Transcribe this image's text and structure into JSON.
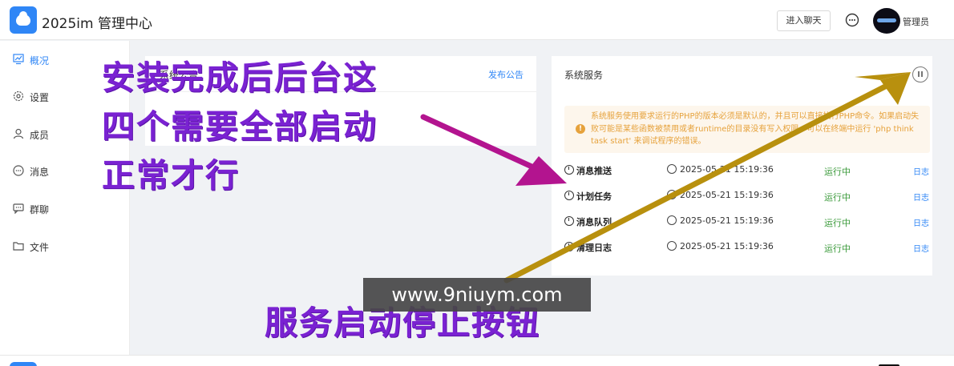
{
  "header": {
    "app_title": "2025im 管理中心",
    "chat_button": "进入聊天",
    "admin_name": "管理员"
  },
  "sidebar": {
    "items": [
      {
        "label": "概况",
        "icon": "dashboard-icon",
        "active": true
      },
      {
        "label": "设置",
        "icon": "gear-icon"
      },
      {
        "label": "成员",
        "icon": "user-icon"
      },
      {
        "label": "消息",
        "icon": "message-icon"
      },
      {
        "label": "群聊",
        "icon": "group-chat-icon"
      },
      {
        "label": "文件",
        "icon": "folder-icon"
      }
    ]
  },
  "announcement": {
    "title": "系统公告",
    "publish_link": "发布公告"
  },
  "services": {
    "title": "系统服务",
    "notice": "系统服务使用要求运行的PHP的版本必须是默认的，并且可以直接执行PHP命令。如果启动失败可能是某些函数被禁用或者runtime的目录没有写入权限，可以在终端中运行 'php think task start' 来调试程序的错误。",
    "rows": [
      {
        "name": "消息推送",
        "time": "2025-05-21 15:19:36",
        "status": "运行中",
        "log": "日志"
      },
      {
        "name": "计划任务",
        "time": "2025-05-21 15:19:36",
        "status": "运行中",
        "log": "日志"
      },
      {
        "name": "消息队列",
        "time": "2025-05-21 15:19:36",
        "status": "运行中",
        "log": "日志"
      },
      {
        "name": "清理日志",
        "time": "2025-05-21 15:19:36",
        "status": "运行中",
        "log": "日志"
      }
    ]
  },
  "annotations": {
    "line1": "安装完成后后台这",
    "line2": "四个需要全部启动",
    "line3": "正常才行",
    "bottom": "服务启动停止按钮",
    "watermark": "www.9niuym.com"
  },
  "colors": {
    "primary": "#2f86f6",
    "running": "#3a9a3a",
    "warning": "#e6a23c",
    "annotation_text": "#7a22d2",
    "arrow_magenta": "#b3148f",
    "arrow_gold": "#b8900e"
  }
}
